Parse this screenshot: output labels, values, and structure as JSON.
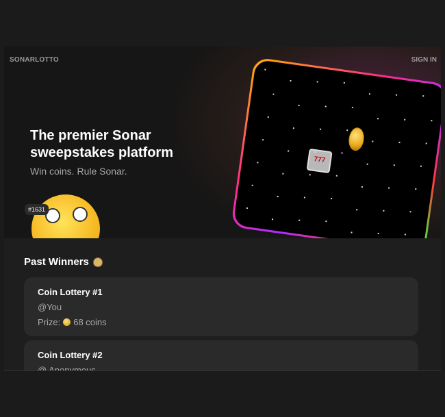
{
  "header": {
    "brand": "SONARLOTTO",
    "sign_in": "SIGN IN"
  },
  "hero": {
    "headline": "The premier Sonar sweepstakes platform",
    "subline": "Win coins. Rule Sonar.",
    "badge": "#1631",
    "slot_label": "777"
  },
  "past_winners": {
    "title": "Past Winners",
    "items": [
      {
        "title": "Coin Lottery #1",
        "user": "@You",
        "prize_label": "Prize:",
        "prize": "68 coins"
      },
      {
        "title": "Coin Lottery #2",
        "user": "@ Anonymous",
        "prize_label": "",
        "prize": ""
      }
    ]
  }
}
